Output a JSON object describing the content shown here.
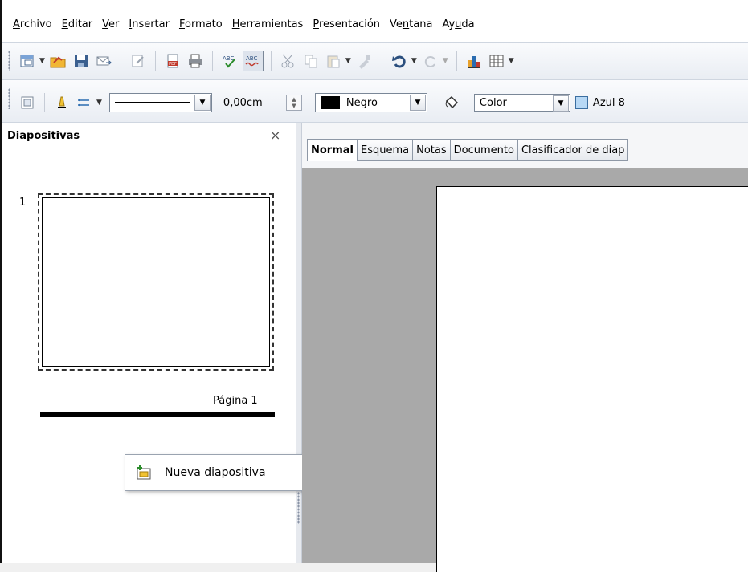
{
  "menubar": {
    "items": [
      {
        "pre": "",
        "ul": "A",
        "post": "rchivo"
      },
      {
        "pre": "",
        "ul": "E",
        "post": "ditar"
      },
      {
        "pre": "",
        "ul": "V",
        "post": "er"
      },
      {
        "pre": "",
        "ul": "I",
        "post": "nsertar"
      },
      {
        "pre": "",
        "ul": "F",
        "post": "ormato"
      },
      {
        "pre": "",
        "ul": "H",
        "post": "erramientas"
      },
      {
        "pre": "",
        "ul": "P",
        "post": "resentación"
      },
      {
        "pre": "Ve",
        "ul": "n",
        "post": "tana"
      },
      {
        "pre": "Ay",
        "ul": "u",
        "post": "da"
      }
    ]
  },
  "toolbar2": {
    "line_width": "0,00cm",
    "line_color": "Negro",
    "fill_type": "Color",
    "fill_color": "Azul 8",
    "fill_color_swatch": "#b7d8f5",
    "line_color_swatch": "#000000"
  },
  "slides_pane": {
    "title": "Diapositivas",
    "close": "×",
    "slide_number": "1",
    "slide_label": "Página 1"
  },
  "context_menu": {
    "item_ul": "N",
    "item_rest": "ueva diapositiva",
    "icon": "new-slide-icon"
  },
  "tabs": [
    "Normal",
    "Esquema",
    "Notas",
    "Documento",
    "Clasificador de diap"
  ],
  "active_tab": "Normal",
  "colors": {
    "workspace": "#a9a9a9",
    "accent_blue": "#3b6ea0"
  }
}
